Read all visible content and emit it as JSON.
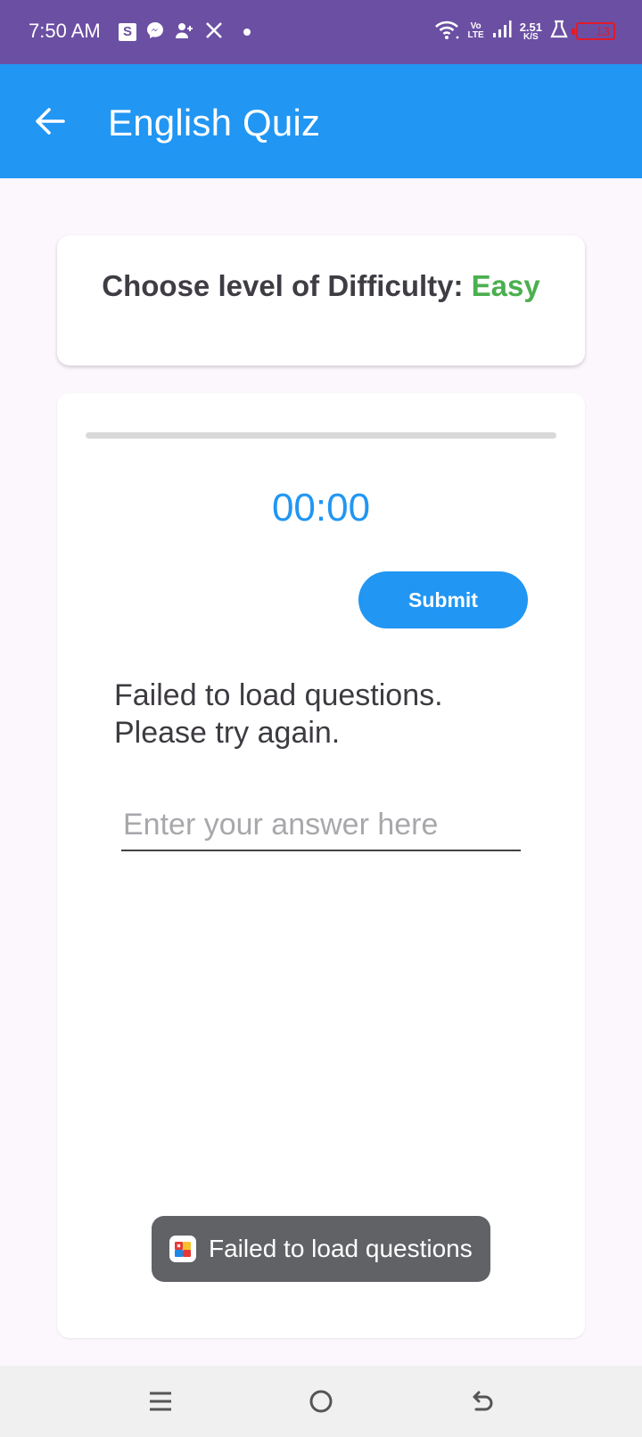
{
  "status_bar": {
    "time": "7:50 AM",
    "notification_icons": [
      "s-app-icon",
      "messenger-icon",
      "contacts-icon",
      "x-icon"
    ],
    "volte_top": "Vo",
    "volte_bottom": "LTE",
    "net_speed_value": "2.51",
    "net_speed_unit": "K/S",
    "battery_level": "13"
  },
  "app_bar": {
    "title": "English Quiz",
    "back_icon": "arrow-left-icon",
    "color": "#2196f3"
  },
  "difficulty": {
    "label": "Choose level of Difficulty:",
    "value": "Easy",
    "value_color": "#4caf50"
  },
  "quiz": {
    "progress": 0,
    "timer": "00:00",
    "submit_label": "Submit",
    "error_message": "Failed to load questions. Please try again.",
    "answer_placeholder": "Enter your answer here",
    "answer_value": ""
  },
  "toast": {
    "message": "Failed to load questions"
  },
  "nav_bar": {
    "icons": [
      "menu-icon",
      "home-icon",
      "back-icon"
    ]
  }
}
